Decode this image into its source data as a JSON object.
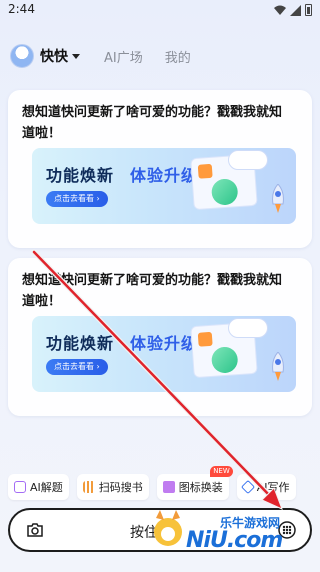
{
  "status": {
    "time": "2:44"
  },
  "header": {
    "user_name": "快快",
    "tabs": [
      {
        "label": "AI广场"
      },
      {
        "label": "我的"
      }
    ]
  },
  "cards": [
    {
      "text": "想知道快问更新了啥可爱的功能？戳戳我就知道啦！",
      "banner": {
        "title_a": "功能焕新",
        "title_b": "体验升级",
        "button": "点击去看看 ›"
      }
    },
    {
      "text": "想知道快问更新了啥可爱的功能？戳戳我就知道啦！",
      "banner": {
        "title_a": "功能焕新",
        "title_b": "体验升级",
        "button": "点击去看看 ›"
      }
    }
  ],
  "chips": [
    {
      "label": "AI解题",
      "icon": "ai-solve-icon"
    },
    {
      "label": "扫码搜书",
      "icon": "barcode-icon"
    },
    {
      "label": "图标换装",
      "icon": "shirt-icon",
      "badge": "NEW"
    },
    {
      "label": "AI写作",
      "icon": "pen-icon"
    }
  ],
  "input_bar": {
    "voice_label": "按住"
  },
  "watermark": {
    "brand_cn": "乐牛游戏网",
    "brand_url": "NiU.com"
  },
  "colors": {
    "accent": "#2f5fe8",
    "arrow": "#e0242c",
    "badge": "#ff4a3c"
  }
}
